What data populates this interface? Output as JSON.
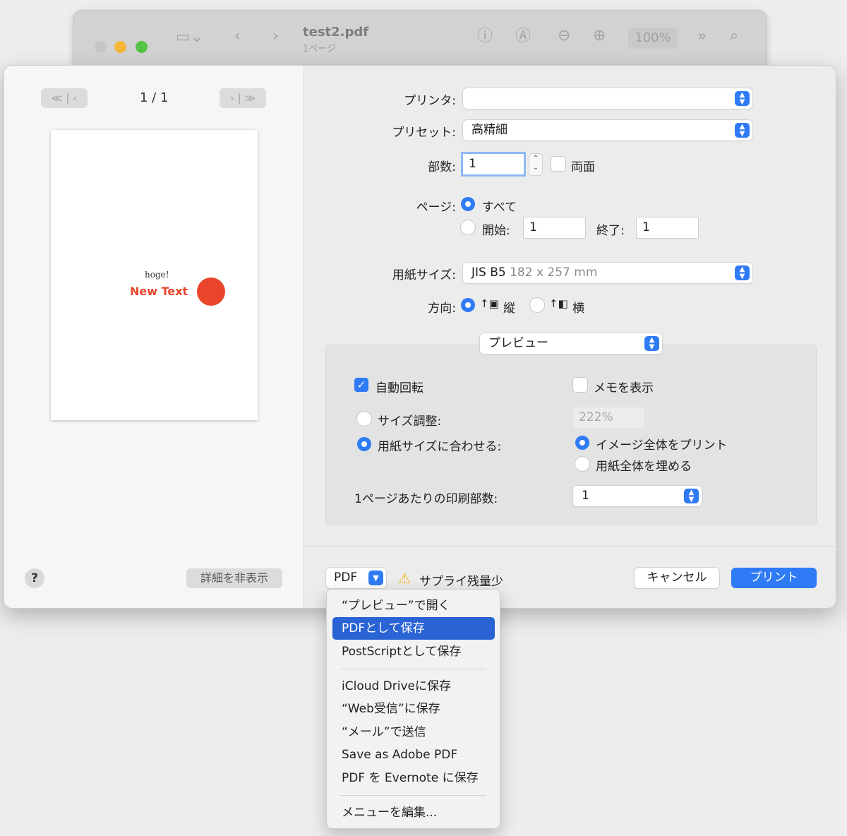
{
  "window": {
    "title": "test2.pdf",
    "subtitle": "1ページ",
    "zoom": "100%"
  },
  "preview_pane": {
    "page_indicator": "1 / 1",
    "first_prev": "≪ | ‹",
    "next_last": "› | ≫",
    "page_text_small": "hoge!",
    "page_text_large": "New Text",
    "help": "?",
    "hide_details": "詳細を非表示"
  },
  "form": {
    "printer_label": "プリンタ:",
    "printer_value": "",
    "preset_label": "プリセット:",
    "preset_value": "高精細",
    "copies_label": "部数:",
    "copies_value": "1",
    "duplex_label": "両面",
    "pages_label": "ページ:",
    "pages_all": "すべて",
    "pages_from_label": "開始:",
    "pages_from_value": "1",
    "pages_to_label": "終了:",
    "pages_to_value": "1",
    "paper_label": "用紙サイズ:",
    "paper_value": "JIS B5",
    "paper_dims": "182 x 257 mm",
    "orientation_label": "方向:",
    "portrait": "縦",
    "landscape": "横"
  },
  "preview_section": {
    "dropdown": "プレビュー",
    "auto_rotate": "自動回転",
    "show_notes": "メモを表示",
    "scale": "サイズ調整:",
    "scale_value": "222%",
    "fit_to_paper": "用紙サイズに合わせる:",
    "print_entire": "イメージ全体をプリント",
    "fill_paper": "用紙全体を埋める",
    "copies_per_page_label": "1ページあたりの印刷部数:",
    "copies_per_page_value": "1"
  },
  "footer": {
    "pdf_button": "PDF",
    "supply_warning": "サプライ残量少",
    "cancel": "キャンセル",
    "print": "プリント"
  },
  "pdf_menu": {
    "items": [
      "“プレビュー”で開く",
      "PDFとして保存",
      "PostScriptとして保存",
      "iCloud Driveに保存",
      "“Web受信”に保存",
      "“メール”で送信",
      "Save as Adobe PDF",
      "PDF を Evernote に保存",
      "メニューを編集..."
    ],
    "selected_index": 1
  },
  "colors": {
    "accent": "#2f7bf6",
    "menu_selection": "#2a63d4",
    "page_red": "#e8452a",
    "warning": "#f2b51c"
  }
}
